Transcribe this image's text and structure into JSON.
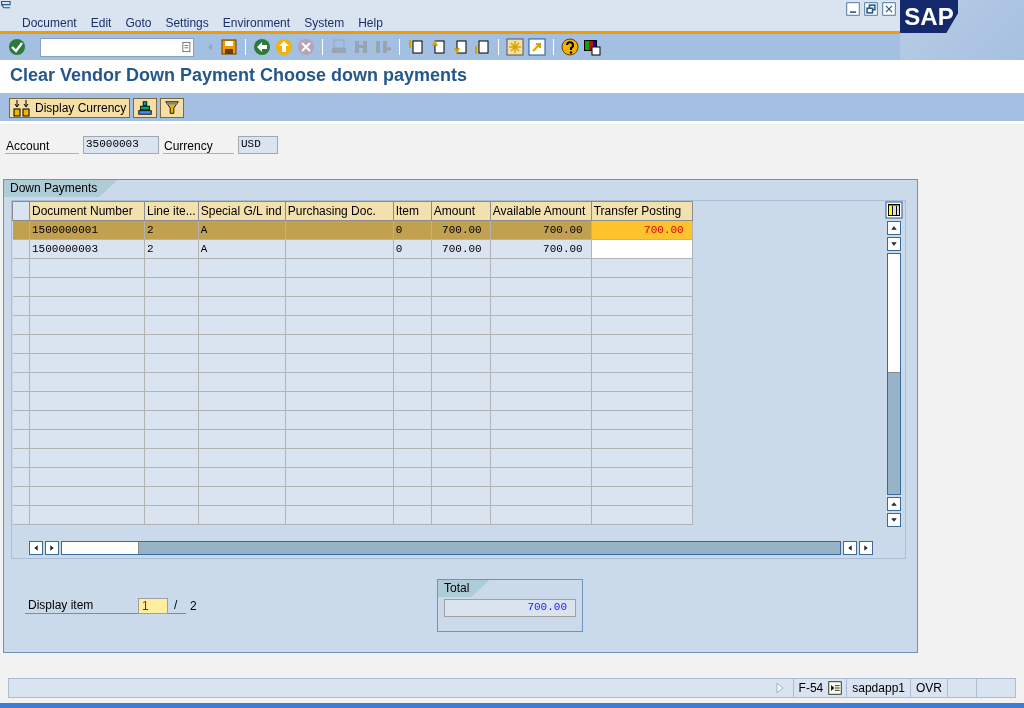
{
  "menu": [
    "Document",
    "Edit",
    "Goto",
    "Settings",
    "Environment",
    "System",
    "Help"
  ],
  "logo": "SAP",
  "title": "Clear Vendor Down Payment Choose down payments",
  "app_toolbar": {
    "button": "Display Currency"
  },
  "header_fields": [
    {
      "label": "Account",
      "value": "35000003"
    },
    {
      "label": "Currency",
      "value": "USD"
    }
  ],
  "down_payments": {
    "title": "Down Payments",
    "columns": [
      "Document Number",
      "Line ite...",
      "Special G/L ind",
      "Purchasing Doc.",
      "Item",
      "Amount",
      "Available Amount",
      "Transfer Posting"
    ],
    "rows": [
      {
        "selected": true,
        "cells": [
          "1500000001",
          "2",
          "A",
          "",
          "0",
          "700.00",
          "700.00",
          "700.00"
        ]
      },
      {
        "selected": false,
        "cells": [
          "1500000003",
          "2",
          "A",
          "",
          "0",
          "700.00",
          "700.00",
          ""
        ]
      }
    ],
    "display_item": {
      "label": "Display item",
      "value": "1",
      "separator": "/",
      "count": "2"
    },
    "total": {
      "title": "Total",
      "value": "700.00"
    }
  },
  "status_bar": {
    "transaction": "F-54",
    "server": "sapdapp1",
    "mode": "OVR"
  }
}
